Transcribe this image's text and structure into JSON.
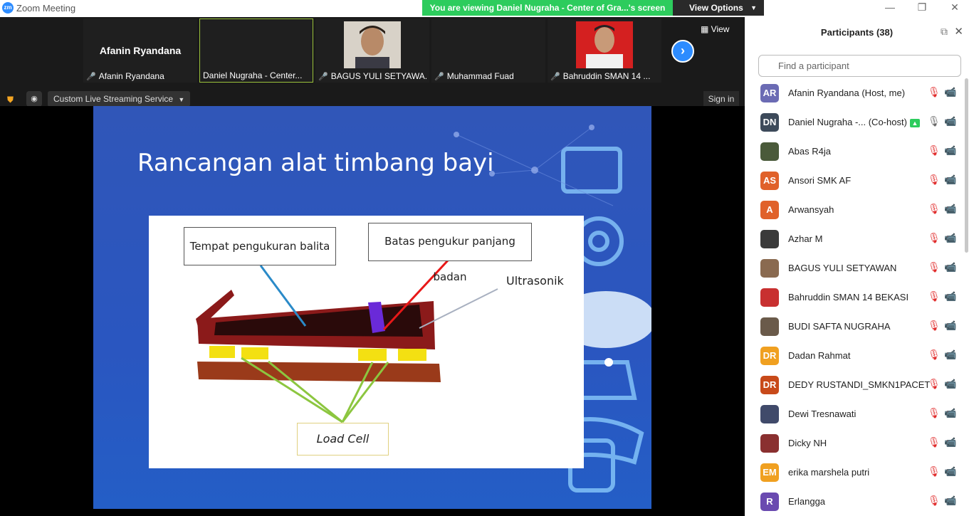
{
  "window": {
    "title": "Zoom Meeting",
    "logo": "zm",
    "minimize": "—",
    "restore": "❐",
    "close": "✕"
  },
  "banner": {
    "text": "You are viewing Daniel Nugraha - Center of Gra...'s screen",
    "view_options": "View Options"
  },
  "strip": {
    "tiles": [
      {
        "bigname": "Afanin Ryandana",
        "name": "Afanin Ryandana",
        "muted": true
      },
      {
        "bigname": "",
        "name": "Daniel Nugraha - Center...",
        "muted": false
      },
      {
        "bigname": "",
        "name": "BAGUS YULI SETYAWA...",
        "muted": true
      },
      {
        "bigname": "",
        "name": "Muhammad Fuad",
        "muted": true
      },
      {
        "bigname": "",
        "name": "Bahruddin SMAN 14 ...",
        "muted": true
      }
    ],
    "view_label": "View"
  },
  "toolbar": {
    "livestream_label": "Custom Live Streaming Service",
    "signin_label": "Sign in"
  },
  "slide": {
    "title": "Rancangan alat timbang bayi",
    "labels": {
      "place": "Tempat pengukuran balita",
      "limit": "Batas pengukur panjang badan",
      "ultrasonic": "Ultrasonik",
      "loadcell": "Load Cell"
    }
  },
  "panel": {
    "title": "Participants (38)",
    "search_placeholder": "Find a participant",
    "participants": [
      {
        "initials": "AR",
        "name": "Afanin Ryandana (Host, me)",
        "color": "#6b6bb4",
        "muted": true
      },
      {
        "initials": "DN",
        "name": "Daniel Nugraha -... (Co-host)",
        "color": "#3d4a5a",
        "muted": false,
        "sharing": true
      },
      {
        "initials": "",
        "name": "Abas R4ja",
        "color": "#4a5a3a",
        "muted": true
      },
      {
        "initials": "AS",
        "name": "Ansori SMK AF",
        "color": "#e0612a",
        "muted": true
      },
      {
        "initials": "A",
        "name": "Arwansyah",
        "color": "#e0612a",
        "muted": true
      },
      {
        "initials": "",
        "name": "Azhar M",
        "color": "#3a3a3a",
        "muted": true
      },
      {
        "initials": "",
        "name": "BAGUS YULI SETYAWAN",
        "color": "#8a6a50",
        "muted": true
      },
      {
        "initials": "",
        "name": "Bahruddin SMAN 14 BEKASI",
        "color": "#c83030",
        "muted": true
      },
      {
        "initials": "",
        "name": "BUDI SAFTA NUGRAHA",
        "color": "#6a5a4a",
        "muted": true
      },
      {
        "initials": "DR",
        "name": "Dadan Rahmat",
        "color": "#f0a020",
        "muted": true
      },
      {
        "initials": "DR",
        "name": "DEDY RUSTANDI_SMKN1PACET",
        "color": "#c84a1a",
        "muted": true
      },
      {
        "initials": "",
        "name": "Dewi Tresnawati",
        "color": "#404a6a",
        "muted": true
      },
      {
        "initials": "",
        "name": "Dicky NH",
        "color": "#8a3030",
        "muted": true
      },
      {
        "initials": "EM",
        "name": "erika marshela putri",
        "color": "#f0a020",
        "muted": true
      },
      {
        "initials": "R",
        "name": "Erlangga",
        "color": "#6a4ab0",
        "muted": true
      }
    ]
  }
}
